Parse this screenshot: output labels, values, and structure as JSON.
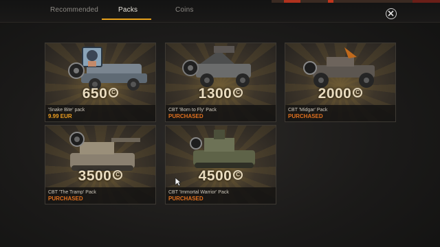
{
  "tabs": [
    {
      "label": "Recommended"
    },
    {
      "label": "Packs"
    },
    {
      "label": "Coins"
    }
  ],
  "active_tab": "Packs",
  "cards": [
    {
      "name": "'Snake Bite' pack",
      "amount": "650",
      "status": "9.99 EUR",
      "status_type": "price"
    },
    {
      "name": "CBT 'Born to Fly' Pack",
      "amount": "1300",
      "status": "PURCHASED",
      "status_type": "purchased"
    },
    {
      "name": "CBT 'Midgar' Pack",
      "amount": "2000",
      "status": "PURCHASED",
      "status_type": "purchased"
    },
    {
      "name": "CBT 'The Tramp' Pack",
      "amount": "3500",
      "status": "PURCHASED",
      "status_type": "purchased"
    },
    {
      "name": "CBT 'Immortal Warrior' Pack",
      "amount": "4500",
      "status": "PURCHASED",
      "status_type": "purchased"
    }
  ],
  "coin_symbol": "C",
  "icons": {
    "close": "close-icon",
    "coin": "coin-icon"
  },
  "colors": {
    "accent": "#e8a21c",
    "purchased": "#e0701e",
    "price": "#f0a020"
  }
}
